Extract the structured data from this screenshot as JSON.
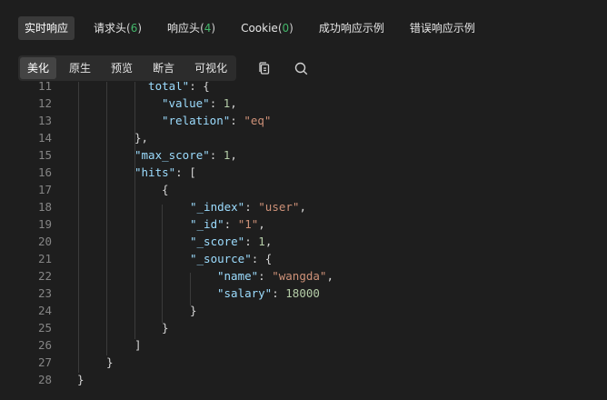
{
  "tabs": [
    {
      "label": "实时响应",
      "active": true
    },
    {
      "label": "请求头",
      "count": "6"
    },
    {
      "label": "响应头",
      "count": "4"
    },
    {
      "label": "Cookie",
      "count": "0"
    },
    {
      "label": "成功响应示例"
    },
    {
      "label": "错误响应示例"
    }
  ],
  "view_modes": [
    "美化",
    "原生",
    "预览",
    "断言",
    "可视化"
  ],
  "toolbar_icons": [
    "copy-icon",
    "search-icon"
  ],
  "code_lines": [
    {
      "n": "11",
      "text": "total\": {"
    },
    {
      "n": "12",
      "text": "\"value\": 1,"
    },
    {
      "n": "13",
      "text": "\"relation\": \"eq\""
    },
    {
      "n": "14",
      "text": "},"
    },
    {
      "n": "15",
      "text": "\"max_score\": 1,"
    },
    {
      "n": "16",
      "text": "\"hits\": ["
    },
    {
      "n": "17",
      "text": "{"
    },
    {
      "n": "18",
      "text": "\"_index\": \"user\","
    },
    {
      "n": "19",
      "text": "\"_id\": \"1\","
    },
    {
      "n": "20",
      "text": "\"_score\": 1,"
    },
    {
      "n": "21",
      "text": "\"_source\": {"
    },
    {
      "n": "22",
      "text": "\"name\": \"wangda\","
    },
    {
      "n": "23",
      "text": "\"salary\": 18000"
    },
    {
      "n": "24",
      "text": "}"
    },
    {
      "n": "25",
      "text": "}"
    },
    {
      "n": "26",
      "text": "]"
    },
    {
      "n": "27",
      "text": "}"
    },
    {
      "n": "28",
      "text": "}"
    }
  ],
  "colors": {
    "key": "#9cdcfe",
    "string": "#ce9178",
    "number": "#b5cea8",
    "count": "#43b66a"
  }
}
